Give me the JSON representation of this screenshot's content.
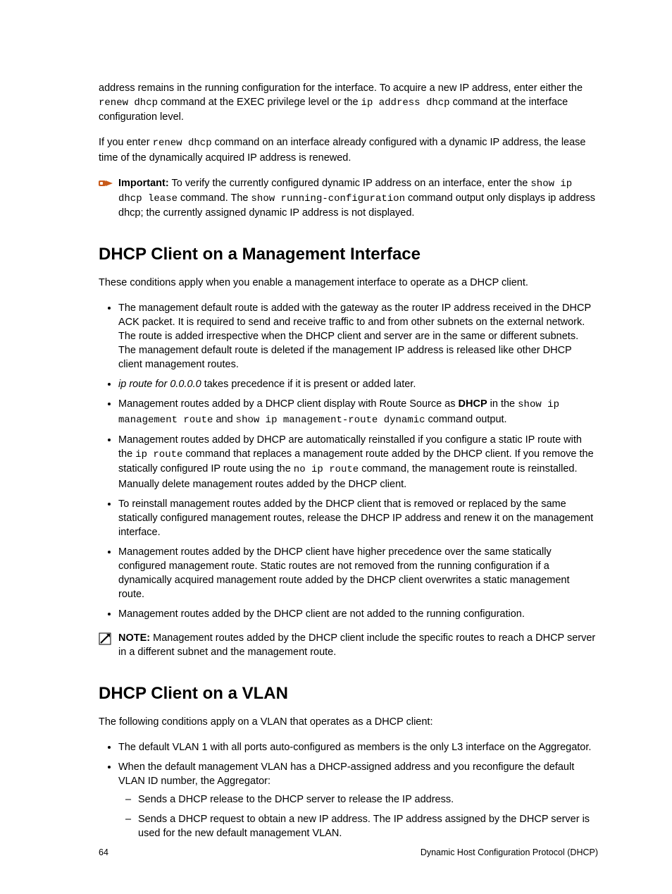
{
  "intro": {
    "p1_a": "address remains in the running configuration for the interface. To acquire a new IP address, enter either the ",
    "p1_code1": "renew dhcp",
    "p1_b": " command at the EXEC privilege level or the ",
    "p1_code2": "ip address dhcp",
    "p1_c": " command at the interface configuration level.",
    "p2_a": "If you enter ",
    "p2_code1": "renew dhcp",
    "p2_b": " command on an interface already configured with a dynamic IP address, the lease time of the dynamically acquired IP address is renewed."
  },
  "importantCallout": {
    "label": "Important:",
    "a": " To verify the currently configured dynamic IP address on an interface, enter the ",
    "code1": "show ip dhcp lease",
    "b": " command. The ",
    "code2": "show running-configuration",
    "c": " command output only displays ip address dhcp; the currently assigned dynamic IP address is not displayed."
  },
  "section1": {
    "heading": "DHCP Client on a Management Interface",
    "intro": "These conditions apply when you enable a management interface to operate as a DHCP client.",
    "li1": "The management default route is added with the gateway as the router IP address received in the DHCP ACK packet. It is required to send and receive traffic to and from other subnets on the external network. The route is added irrespective when the DHCP client and server are in the same or different subnets. The management default route is deleted if the management IP address is released like other DHCP client management routes.",
    "li2_i": "ip route for 0.0.0.0",
    "li2_b": " takes precedence if it is present or added later.",
    "li3_a": "Management routes added by a DHCP client display with Route Source as ",
    "li3_bold": "DHCP",
    "li3_b": " in the ",
    "li3_code1": "show ip management route",
    "li3_c": " and ",
    "li3_code2": "show ip management-route dynamic",
    "li3_d": " command output.",
    "li4_a": "Management routes added by DHCP are automatically reinstalled if you configure a static IP route with the ",
    "li4_code1": "ip route",
    "li4_b": " command that replaces a management route added by the DHCP client. If you remove the statically configured IP route using the ",
    "li4_code2": "no ip route",
    "li4_c": " command, the management route is reinstalled. Manually delete management routes added by the DHCP client.",
    "li5": "To reinstall management routes added by the DHCP client that is removed or replaced by the same statically configured management routes, release the DHCP IP address and renew it on the management interface.",
    "li6": "Management routes added by the DHCP client have higher precedence over the same statically configured management route. Static routes are not removed from the running configuration if a dynamically acquired management route added by the DHCP client overwrites a static management route.",
    "li7": "Management routes added by the DHCP client are not added to the running configuration."
  },
  "noteCallout": {
    "label": "NOTE:",
    "text": " Management routes added by the DHCP client include the specific routes to reach a DHCP server in a different subnet and the management route."
  },
  "section2": {
    "heading": "DHCP Client on a VLAN",
    "intro": "The following conditions apply on a VLAN that operates as a DHCP client:",
    "li1": "The default VLAN 1 with all ports auto-configured as members is the only L3 interface on the Aggregator.",
    "li2": "When the default management VLAN has a DHCP-assigned address and you reconfigure the default VLAN ID number, the Aggregator:",
    "li2_sub1": "Sends a DHCP release to the DHCP server to release the IP address.",
    "li2_sub2": "Sends a DHCP request to obtain a new IP address. The IP address assigned by the DHCP server is used for the new default management VLAN."
  },
  "footer": {
    "pageNum": "64",
    "title": "Dynamic Host Configuration Protocol (DHCP)"
  }
}
